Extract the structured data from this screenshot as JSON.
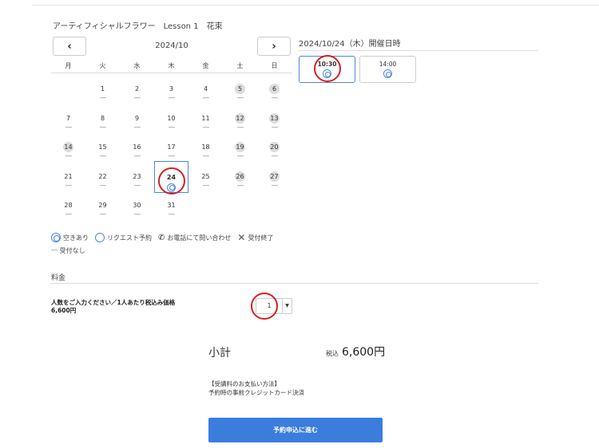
{
  "course_title": "アーティフィシャルフラワー　Lesson 1　花束",
  "calendar": {
    "prev_label": "‹",
    "next_label": "›",
    "month_label": "2024/10",
    "weekdays": [
      "月",
      "火",
      "水",
      "木",
      "金",
      "土",
      "日"
    ],
    "weeks": [
      [
        {
          "num": "",
          "status": ""
        },
        {
          "num": "1",
          "status": "-----"
        },
        {
          "num": "2",
          "status": "-----"
        },
        {
          "num": "3",
          "status": "-----"
        },
        {
          "num": "4",
          "status": "-----"
        },
        {
          "num": "5",
          "status": "-----",
          "gray": true
        },
        {
          "num": "6",
          "status": "-----",
          "gray": true
        }
      ],
      [
        {
          "num": "7",
          "status": "-----"
        },
        {
          "num": "8",
          "status": "-----"
        },
        {
          "num": "9",
          "status": "-----"
        },
        {
          "num": "10",
          "status": "-----"
        },
        {
          "num": "11",
          "status": "-----"
        },
        {
          "num": "12",
          "status": "-----",
          "gray": true
        },
        {
          "num": "13",
          "status": "-----",
          "gray": true
        }
      ],
      [
        {
          "num": "14",
          "status": "-----",
          "gray": true
        },
        {
          "num": "15",
          "status": "-----"
        },
        {
          "num": "16",
          "status": "-----"
        },
        {
          "num": "17",
          "status": "-----"
        },
        {
          "num": "18",
          "status": "-----"
        },
        {
          "num": "19",
          "status": "-----",
          "gray": true
        },
        {
          "num": "20",
          "status": "-----",
          "gray": true
        }
      ],
      [
        {
          "num": "21",
          "status": "-----"
        },
        {
          "num": "22",
          "status": "-----"
        },
        {
          "num": "23",
          "status": "-----"
        },
        {
          "num": "24",
          "status": "available",
          "selected": true
        },
        {
          "num": "25",
          "status": "-----"
        },
        {
          "num": "26",
          "status": "-----",
          "gray": true
        },
        {
          "num": "27",
          "status": "-----",
          "gray": true
        }
      ],
      [
        {
          "num": "28",
          "status": "-----"
        },
        {
          "num": "29",
          "status": "-----"
        },
        {
          "num": "30",
          "status": "-----"
        },
        {
          "num": "31",
          "status": "-----"
        },
        {
          "num": "",
          "status": ""
        },
        {
          "num": "",
          "status": ""
        },
        {
          "num": "",
          "status": ""
        }
      ]
    ]
  },
  "legend": {
    "available": "空きあり",
    "request": "リクエスト予約",
    "phone": "お電話にて問い合わせ",
    "closed": "受付終了",
    "none_mark": "-----",
    "none": "受付なし"
  },
  "side": {
    "date_heading": "2024/10/24（木）開催日時",
    "slots": [
      {
        "time": "10:30",
        "active": true
      },
      {
        "time": "14:00",
        "active": false
      }
    ]
  },
  "fee": {
    "heading": "料金",
    "label_line1": "人数をご入力ください／1人あたり税込み価格",
    "label_line2": "6,600円",
    "quantity": "1"
  },
  "summary": {
    "subtotal_label": "小計",
    "tax_label": "税込",
    "subtotal_value": "6,600円"
  },
  "payment": {
    "line1": "【受講料のお支払い方法】",
    "line2": "予約時の事前クレジットカード決済"
  },
  "submit_label": "予約申込に進む",
  "colors": {
    "accent": "#3b7ddd",
    "highlight": "#d62020"
  }
}
